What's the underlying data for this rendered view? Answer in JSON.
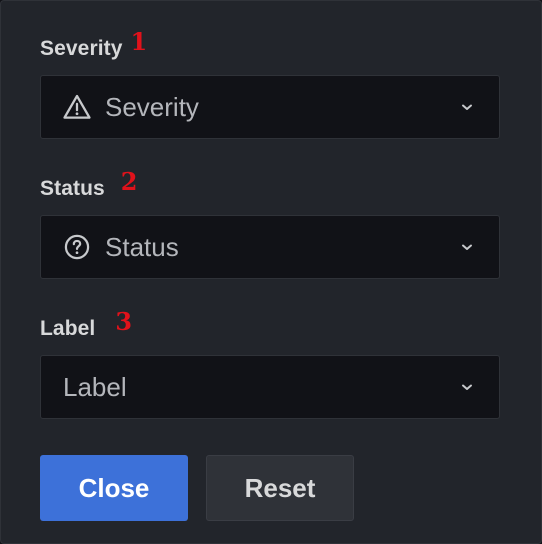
{
  "filters": [
    {
      "label": "Severity",
      "annotation": "1",
      "placeholder": "Severity",
      "icon": "warning-triangle-icon"
    },
    {
      "label": "Status",
      "annotation": "2",
      "placeholder": "Status",
      "icon": "question-circle-icon"
    },
    {
      "label": "Label",
      "annotation": "3",
      "placeholder": "Label",
      "icon": ""
    }
  ],
  "actions": {
    "close_label": "Close",
    "reset_label": "Reset"
  },
  "colors": {
    "panel_bg": "#22252b",
    "select_bg": "#111217",
    "primary": "#3d71d9",
    "secondary": "#2f3238",
    "annotation": "#e0121b"
  }
}
